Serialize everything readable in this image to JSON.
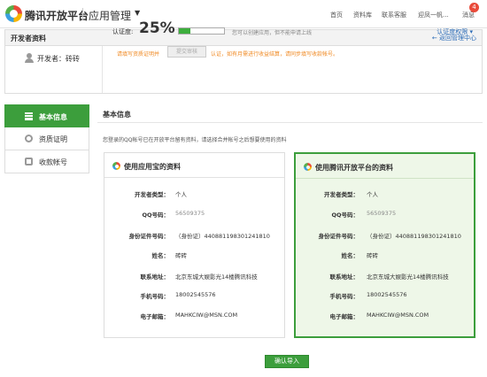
{
  "header": {
    "brand": "腾讯开放平台",
    "section": "应用管理",
    "nav": [
      "首页",
      "资料库",
      "联系客服",
      "迎凤一帆...",
      "消息"
    ],
    "message_count": "4"
  },
  "developer": {
    "panel_title": "开发者资料",
    "back_link": "返回管理中心",
    "name_label": "开发者：",
    "name": "砖砖",
    "auth_label": "认证度:",
    "auth_percent": "25%",
    "auth_progress": 0.25,
    "auth_note": "您可以创建应用，但不能申请上线",
    "auth_perm": "认证度权限",
    "warn_prefix": "请填写资质证明并",
    "submit_label": "提交审核",
    "warn_suffix": "认证，如有月需进行收益结算，请同步填写收款帐号。"
  },
  "sidebar": {
    "items": [
      {
        "label": "基本信息",
        "icon": "list-icon",
        "active": true
      },
      {
        "label": "资质证明",
        "icon": "certificate-icon",
        "active": false
      },
      {
        "label": "收款帐号",
        "icon": "wallet-icon",
        "active": false
      }
    ]
  },
  "main": {
    "title": "基本信息",
    "description": "您登录的QQ帐号已在开放平台留有资料，请选择合并帐号之后想要使用的资料"
  },
  "cards": [
    {
      "title": "使用应用宝的资料",
      "selected": false,
      "rows": [
        {
          "label": "开发者类型：",
          "value": "个人"
        },
        {
          "label": "QQ号码：",
          "value": "56509375"
        },
        {
          "label": "身份证件号码：",
          "value": "（身份证）440881198301241810"
        },
        {
          "label": "姓名：",
          "value": "砖砖"
        },
        {
          "label": "联系地址：",
          "value": "北京东城大娱影光14楼腾讯科技"
        },
        {
          "label": "手机号码：",
          "value": "18002545576"
        },
        {
          "label": "电子邮箱：",
          "value": "MAHKCIW@MSN.COM"
        }
      ]
    },
    {
      "title": "使用腾讯开放平台的资料",
      "selected": true,
      "rows": [
        {
          "label": "开发者类型：",
          "value": "个人"
        },
        {
          "label": "QQ号码：",
          "value": "56509375"
        },
        {
          "label": "身份证件号码：",
          "value": "（身份证）440881198301241810"
        },
        {
          "label": "姓名：",
          "value": "砖砖"
        },
        {
          "label": "联系地址：",
          "value": "北京东城大娱影光14楼腾讯科技"
        },
        {
          "label": "手机号码：",
          "value": "18002545576"
        },
        {
          "label": "电子邮箱：",
          "value": "MAHKCIW@MSN.COM"
        }
      ]
    }
  ],
  "confirm_label": "确认导入",
  "colors": {
    "accent": "#3c9e3c",
    "link": "#2a6bb7",
    "warning": "#f08a24"
  }
}
